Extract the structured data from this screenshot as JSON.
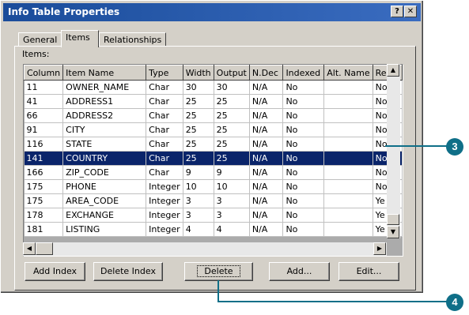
{
  "window": {
    "title": "Info Table Properties",
    "help_btn": "?",
    "close_btn": "✕"
  },
  "tabs": [
    {
      "label": "General"
    },
    {
      "label": "Items"
    },
    {
      "label": "Relationships"
    }
  ],
  "items_label": "Items:",
  "table": {
    "headers": [
      "Column",
      "Item Name",
      "Type",
      "Width",
      "Output",
      "N.Dec",
      "Indexed",
      "Alt. Name",
      "Re"
    ],
    "rows": [
      [
        "11",
        "OWNER_NAME",
        "Char",
        "30",
        "30",
        "N/A",
        "No",
        "",
        "No"
      ],
      [
        "41",
        "ADDRESS1",
        "Char",
        "25",
        "25",
        "N/A",
        "No",
        "",
        "No"
      ],
      [
        "66",
        "ADDRESS2",
        "Char",
        "25",
        "25",
        "N/A",
        "No",
        "",
        "No"
      ],
      [
        "91",
        "CITY",
        "Char",
        "25",
        "25",
        "N/A",
        "No",
        "",
        "No"
      ],
      [
        "116",
        "STATE",
        "Char",
        "25",
        "25",
        "N/A",
        "No",
        "",
        "No"
      ],
      [
        "141",
        "COUNTRY",
        "Char",
        "25",
        "25",
        "N/A",
        "No",
        "",
        "No"
      ],
      [
        "166",
        "ZIP_CODE",
        "Char",
        "9",
        "9",
        "N/A",
        "No",
        "",
        "No"
      ],
      [
        "175",
        "PHONE",
        "Integer",
        "10",
        "10",
        "N/A",
        "No",
        "",
        "No"
      ],
      [
        "175",
        "AREA_CODE",
        "Integer",
        "3",
        "3",
        "N/A",
        "No",
        "",
        "Ye"
      ],
      [
        "178",
        "EXCHANGE",
        "Integer",
        "3",
        "3",
        "N/A",
        "No",
        "",
        "Ye"
      ],
      [
        "181",
        "LISTING",
        "Integer",
        "4",
        "4",
        "N/A",
        "No",
        "",
        "Ye"
      ]
    ]
  },
  "buttons": {
    "add_index": "Add Index",
    "delete_index": "Delete Index",
    "delete": "Delete",
    "add": "Add...",
    "edit": "Edit..."
  },
  "callouts": {
    "three": "3",
    "four": "4"
  },
  "colors": {
    "accent": "#0f6f88",
    "selection": "#0a246a",
    "title_bar": "#1a4c9a"
  }
}
